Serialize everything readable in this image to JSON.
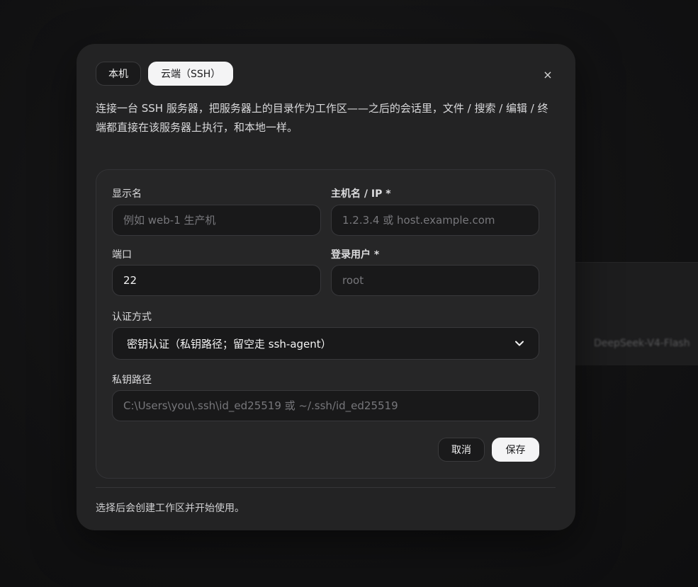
{
  "background": {
    "ghost_label": "DeepSeek-V4-Flash"
  },
  "tabs": [
    {
      "label": "本机",
      "active": false
    },
    {
      "label": "云端（SSH）",
      "active": true
    }
  ],
  "close_label": "×",
  "description": "连接一台 SSH 服务器，把服务器上的目录作为工作区——之后的会话里，文件 / 搜索 / 编辑 / 终端都直接在该服务器上执行，和本地一样。",
  "form": {
    "display_name": {
      "label": "显示名",
      "placeholder": "例如 web-1 生产机",
      "value": ""
    },
    "hostname": {
      "label": "主机名 / IP *",
      "placeholder": "1.2.3.4 或 host.example.com",
      "value": ""
    },
    "port": {
      "label": "端口",
      "value": "22"
    },
    "user": {
      "label": "登录用户 *",
      "placeholder": "root",
      "value": ""
    },
    "auth": {
      "label": "认证方式",
      "selected": "密钥认证（私钥路径；留空走 ssh-agent）"
    },
    "key_path": {
      "label": "私钥路径",
      "placeholder": "C:\\Users\\you\\.ssh\\id_ed25519 或 ~/.ssh/id_ed25519",
      "value": ""
    },
    "cancel_label": "取消",
    "save_label": "保存"
  },
  "footer_note": "选择后会创建工作区并开始使用。",
  "colors": {
    "modal_bg": "#232324",
    "field_bg": "#19191a",
    "primary_button_bg": "#f4f4f5"
  }
}
